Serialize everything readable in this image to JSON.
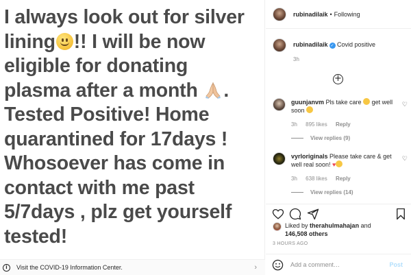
{
  "post": {
    "lines": [
      "I always look out for silver",
      "lining",
      "!! I will be now",
      "eligible for donating",
      "plasma after a month",
      ".",
      "Tested Positive! Home",
      "quarantined for 17days !",
      "Whosoever has come in",
      "contact with me past",
      "5/7days , plz get yourself",
      "tested!"
    ]
  },
  "info_bar": {
    "text": "Visit the COVID-19 Information Center."
  },
  "header": {
    "username": "rubinadilaik",
    "dot": "•",
    "following": "Following"
  },
  "caption": {
    "username": "rubinadilaik",
    "text": "Covid positive",
    "time": "3h"
  },
  "comments": [
    {
      "username": "guunjanvm",
      "text_a": "Pls take care",
      "text_b": "get well soon",
      "time": "3h",
      "likes": "895 likes",
      "reply": "Reply",
      "view_replies": "View replies (9)"
    },
    {
      "username": "vyrloriginals",
      "text_a": "Please take care",
      "text_b": "& get well real soon!",
      "time": "3h",
      "likes": "638 likes",
      "reply": "Reply",
      "view_replies": "View replies (14)"
    }
  ],
  "likes": {
    "prefix": "Liked by",
    "user": "therahulmahajan",
    "and": "and",
    "count": "146,508 others"
  },
  "timestamp": "3 HOURS AGO",
  "add_comment": {
    "placeholder": "Add a comment…",
    "post": "Post"
  },
  "icons": [
    "info-icon",
    "chevron-right-icon",
    "verified-badge-icon",
    "plus-circle-icon",
    "heart-icon",
    "comment-icon",
    "share-icon",
    "bookmark-icon",
    "smiley-icon"
  ],
  "colors": {
    "verified": "#3897f0",
    "post_button": "#b2dffc",
    "muted": "#8e8e8e",
    "post_text": "#4a4a4a"
  }
}
